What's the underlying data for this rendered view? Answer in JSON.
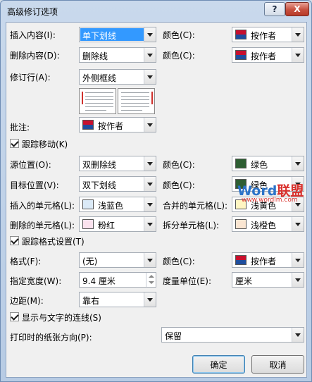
{
  "window": {
    "title": "高级修订选项",
    "help_label": "?",
    "close_label": "X"
  },
  "markup": {
    "insertions_label": "插入内容(I):",
    "insertions_value": "单下划线",
    "insertions_color_label": "颜色(C):",
    "insertions_color_value": "按作者",
    "deletions_label": "删除内容(D):",
    "deletions_value": "删除线",
    "deletions_color_label": "颜色(C):",
    "deletions_color_value": "按作者",
    "changed_lines_label": "修订行(A):",
    "changed_lines_value": "外侧框线",
    "comments_label": "批注:",
    "comments_value": "按作者"
  },
  "moves": {
    "track_moves_label": "跟踪移动(K)",
    "track_moves_checked": true,
    "from_label": "源位置(O):",
    "from_value": "双删除线",
    "from_color_label": "颜色(C):",
    "from_color_value": "绿色",
    "from_color_hex": "#2e5e33",
    "to_label": "目标位置(V):",
    "to_value": "双下划线",
    "to_color_label": "颜色(C):",
    "to_color_value": "绿色",
    "to_color_hex": "#2e5e33"
  },
  "table_cells": {
    "inserted_label": "插入的单元格(L):",
    "inserted_value": "浅蓝色",
    "inserted_hex": "#dbeaf7",
    "merged_label": "合并的单元格(L):",
    "merged_value": "浅黄色",
    "merged_hex": "#fff6c2",
    "deleted_label": "删除的单元格(L):",
    "deleted_value": "粉红",
    "deleted_hex": "#fbe2ee",
    "split_label": "拆分单元格(L):",
    "split_value": "浅橙色",
    "split_hex": "#fbe6d2"
  },
  "formatting": {
    "track_formatting_label": "跟踪格式设置(T)",
    "track_formatting_checked": true,
    "format_label": "格式(F):",
    "format_value": "(无)",
    "format_color_label": "颜色(C):",
    "format_color_value": "按作者"
  },
  "balloons": {
    "width_label": "指定宽度(W):",
    "width_value": "9.4 厘米",
    "measure_label": "度量单位(E):",
    "measure_value": "厘米",
    "margin_label": "边距(M):",
    "margin_value": "靠右",
    "show_lines_label": "显示与文字的连线(S)",
    "show_lines_checked": true,
    "paper_orientation_label": "打印时的纸张方向(P):",
    "paper_orientation_value": "保留"
  },
  "buttons": {
    "ok": "确定",
    "cancel": "取消"
  },
  "watermark": {
    "brand_word": "Word",
    "brand_cn": "联盟",
    "url": "www.wordlm.com"
  },
  "colors": {
    "author_red": "#c8102e",
    "author_blue": "#1f4e9e",
    "selection": "#3399ff",
    "watermark_blue": "#2b73c9",
    "watermark_red": "#d9302c"
  }
}
